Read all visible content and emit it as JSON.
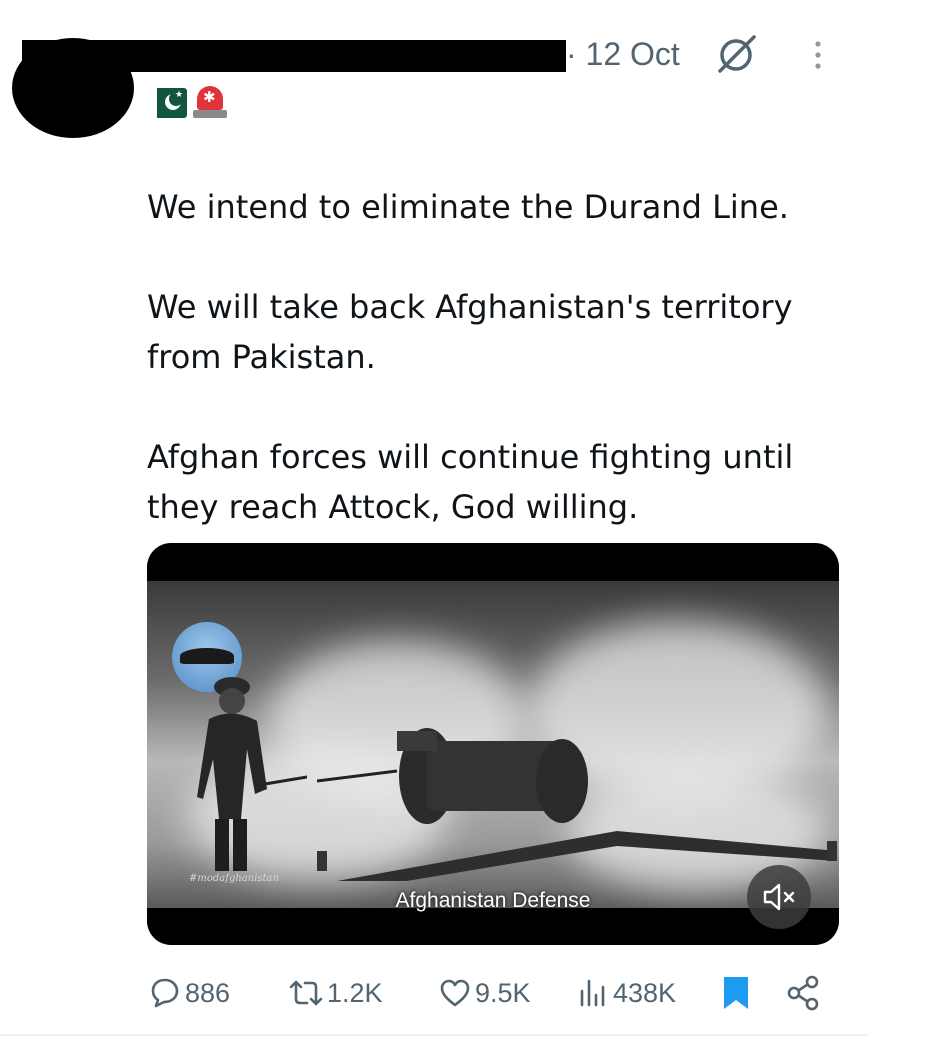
{
  "header": {
    "date": "· 12 Oct",
    "grok_icon": "grok-icon",
    "more_icon": "more-vertical-icon"
  },
  "flags": [
    "pakistan-flag-emoji",
    "rotating-light-emoji"
  ],
  "tweet": {
    "paragraphs": [
      "We intend to eliminate the Durand Line.",
      "We will take back Afghanistan's territory from Pakistan.",
      "Afghan forces will continue fighting until they reach Attock, God willing."
    ]
  },
  "video": {
    "caption": "Afghanistan Defense",
    "watermark": "#modafghanistan",
    "mute_icon": "volume-muted-icon"
  },
  "actions": {
    "replies": "886",
    "reposts": "1.2K",
    "likes": "9.5K",
    "views": "438K",
    "bookmark_color": "#1d9bf0",
    "share_icon": "share-icon"
  }
}
